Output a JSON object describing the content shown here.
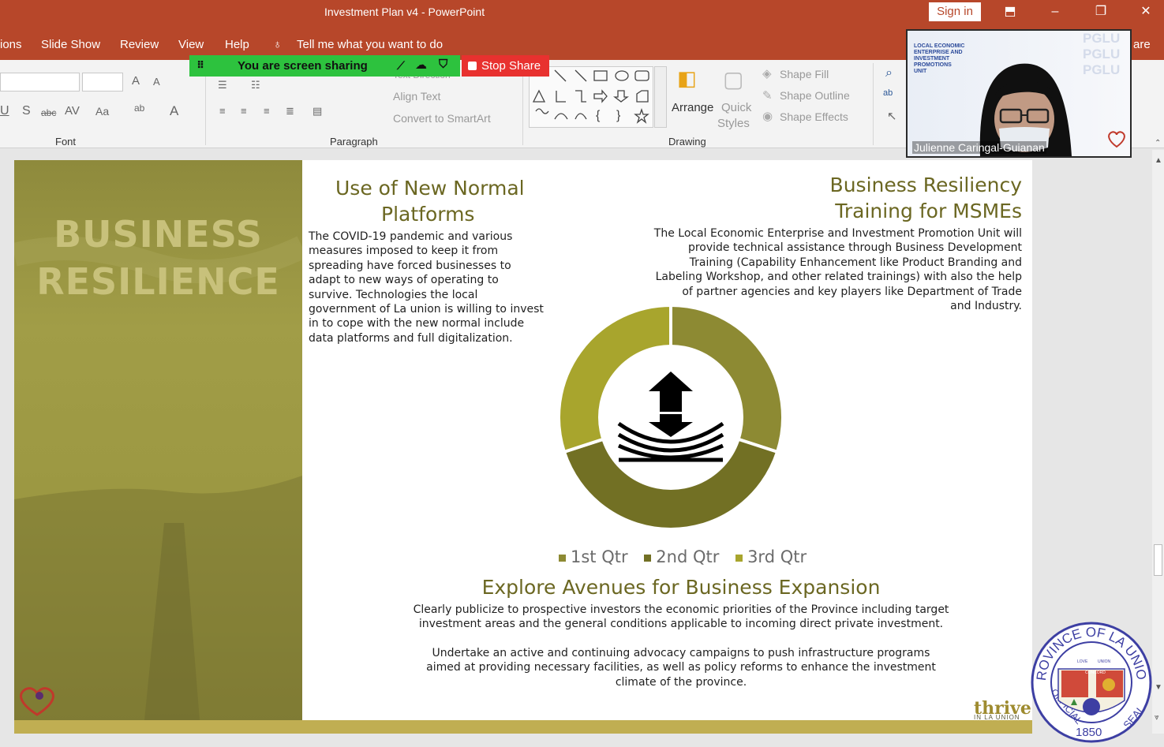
{
  "titlebar": {
    "title": "Investment Plan v4  -  PowerPoint",
    "signin": "Sign in"
  },
  "menu": [
    "ions",
    "Slide Show",
    "Review",
    "View",
    "Help",
    "Tell me what you want to do",
    "are"
  ],
  "ribbon": {
    "font_label": "Font",
    "paragraph_label": "Paragraph",
    "drawing_label": "Drawing",
    "text_direction": "Text Direction",
    "align_text": "Align Text",
    "convert_smartart": "Convert to SmartArt",
    "arrange": "Arrange",
    "quick_styles_1": "Quick",
    "quick_styles_2": "Styles",
    "shape_fill": "Shape Fill",
    "shape_outline": "Shape Outline",
    "shape_effects": "Shape Effects",
    "font_glyph_a1": "A",
    "font_glyph_a2": "A",
    "font_glyph_u": "U",
    "font_glyph_s": "S",
    "font_glyph_abc": "abc",
    "font_glyph_av": "AV",
    "font_glyph_aa": "Aa",
    "font_glyph_ab": "ab",
    "font_glyph_a3": "A"
  },
  "share": {
    "status": "You are screen sharing",
    "stop": "Stop Share"
  },
  "video": {
    "name": "Julienne Caringal-Guianan",
    "board_lines": [
      "LOCAL ECONOMIC",
      "ENTERPRISE AND",
      "INVESTMENT",
      "PROMOTIONS",
      "UNIT"
    ],
    "watermark": [
      "PGLU",
      "PGLU",
      "PGLU"
    ]
  },
  "slide": {
    "brand_line1": "BUSINESS",
    "brand_line2": "RESILIENCE",
    "head1_line1": "Use of New Normal",
    "head1_line2": "Platforms",
    "body1": [
      "The COVID-19 pandemic and various",
      "measures imposed to keep it from",
      "spreading have forced businesses to",
      "adapt to new ways of operating to",
      "survive. Technologies the local",
      "government of La union is willing to invest",
      "in to cope with the new normal include",
      "data platforms and full digitalization."
    ],
    "head2_line1": "Business Resiliency",
    "head2_line2": "Training for MSMEs",
    "body2": [
      "The Local Economic Enterprise and Investment Promotion Unit will",
      "provide technical assistance through Business Development",
      "Training (Capability Enhancement like Product Branding and",
      "Labeling Workshop, and other related trainings) with also the help",
      "of partner agencies and key players like Department of Trade",
      "and Industry."
    ],
    "head3": "Explore Avenues for Business Expansion",
    "body3": [
      "Clearly publicize to prospective investors the economic priorities of the Province including target",
      "investment areas and the general conditions applicable to incoming direct private investment."
    ],
    "body4": [
      "Undertake an active and continuing advocacy campaigns to push infrastructure programs",
      "aimed at providing necessary facilities, as well as policy reforms to enhance the investment",
      "climate of the province."
    ],
    "thrive": "thrive",
    "thrive_sub": "IN LA UNION"
  },
  "chart_data": {
    "type": "pie",
    "categories": [
      "1st Qtr",
      "2nd Qtr",
      "3rd Qtr"
    ],
    "values": [
      30,
      40,
      30
    ],
    "colors": [
      "#8d8a33",
      "#727024",
      "#a8a52d"
    ]
  },
  "seal": {
    "top": "PROVINCE OF LA UNION",
    "left": "OFFICIAL",
    "year": "1850",
    "right": "SEAL",
    "inner": [
      "LOVE",
      "UNION",
      "CONCORD"
    ]
  }
}
